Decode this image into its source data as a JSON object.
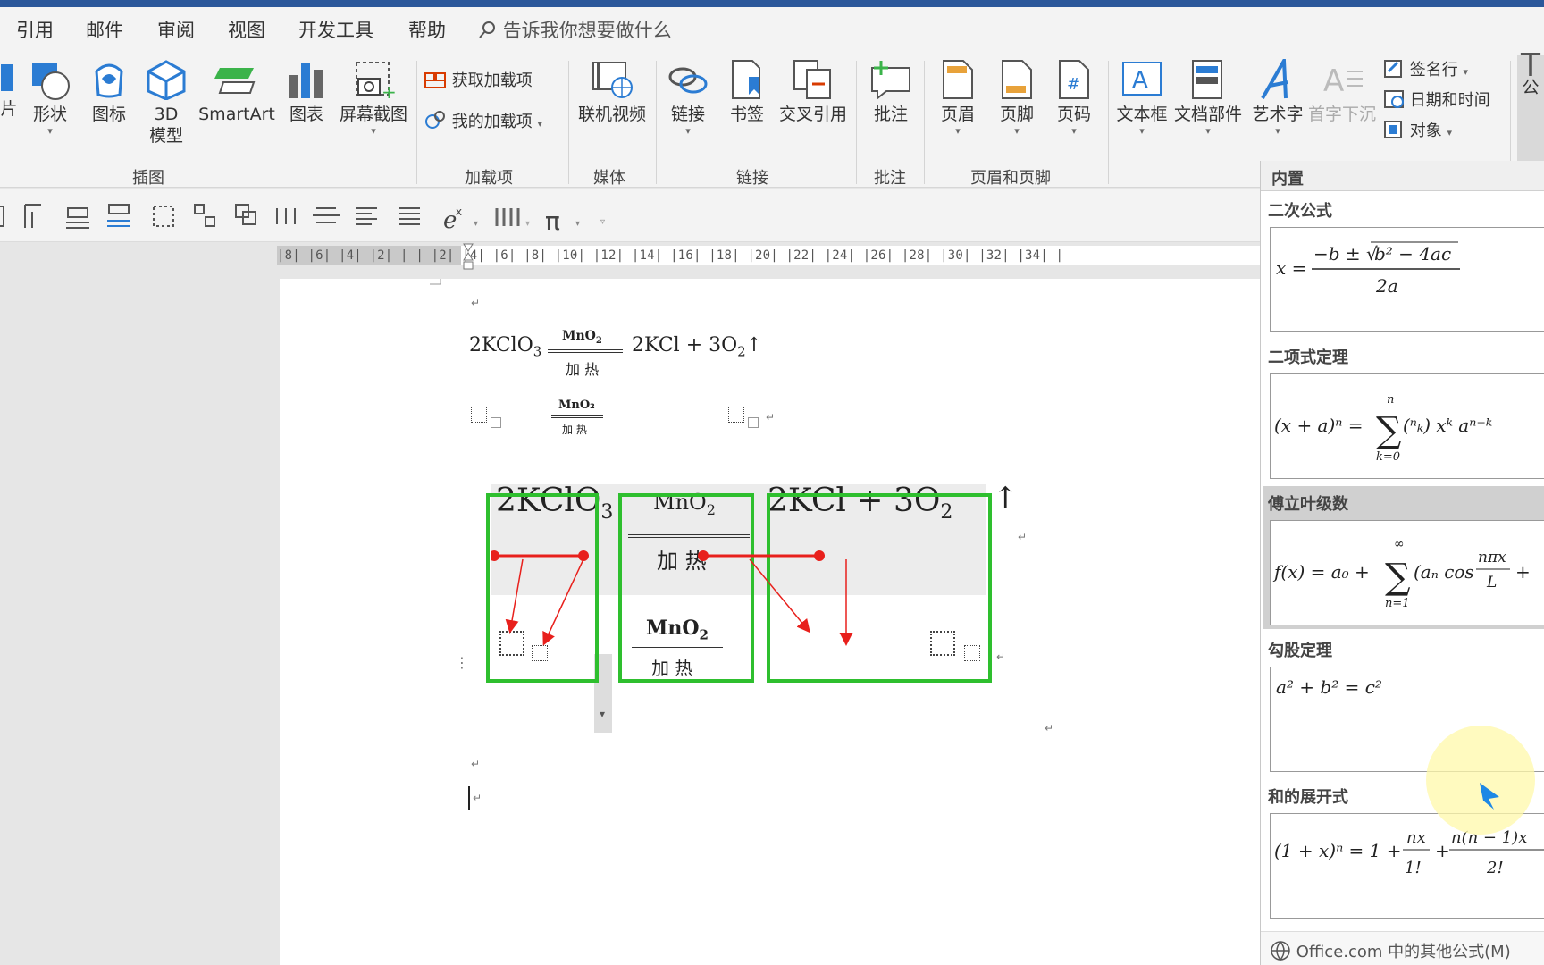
{
  "menu_tabs": [
    "引用",
    "邮件",
    "审阅",
    "视图",
    "开发工具",
    "帮助"
  ],
  "tell_me": "告诉我你想要做什么",
  "ribbon": {
    "illustrations": {
      "picture_partial": "片",
      "shapes": "形状",
      "icons": "图标",
      "model_3d": "3D\n模型",
      "smartart": "SmartArt",
      "chart": "图表",
      "screenshot": "屏幕截图",
      "group": "插图"
    },
    "addins": {
      "get": "获取加载项",
      "mine": "我的加载项",
      "group": "加载项"
    },
    "media": {
      "online_video": "联机视频",
      "group": "媒体"
    },
    "links": {
      "link": "链接",
      "bookmark": "书签",
      "cross_ref": "交叉引用",
      "group": "链接"
    },
    "comments": {
      "comment": "批注",
      "group": "批注"
    },
    "header_footer": {
      "header": "页眉",
      "footer": "页脚",
      "page_number": "页码",
      "group": "页眉和页脚"
    },
    "text": {
      "textbox": "文本框",
      "quick_parts": "文档部件",
      "wordart": "艺术字",
      "drop_cap": "首字下沉",
      "signature": "签名行",
      "datetime": "日期和时间",
      "object": "对象"
    },
    "equation_partial": "公"
  },
  "ruler_text": "|8| |6| |4| |2| | |  |2| |4| |6| |8| |10| |12| |14| |16| |18| |20| |22| |24| |26| |28| |30| |32| |34| |",
  "document": {
    "line1": {
      "left": "2KClO",
      "left_sub": "3",
      "over": "MnO",
      "over_sub": "2",
      "under": "加  热",
      "right": "2KCl  +  3O",
      "right_sub": "2",
      "arrow": "↑"
    },
    "line2": {
      "over": "MnO₂",
      "under": "加 热"
    },
    "big": {
      "left": "2KClO",
      "left_sub": "3",
      "over": "MnO",
      "over_sub": "2",
      "under": "加   热",
      "over2": "MnO",
      "over2_sub": "2",
      "under2": "加 热",
      "right": "2KCl  +  3O",
      "right_sub": "2",
      "arrow": "↑"
    },
    "para_mark": "↵"
  },
  "panel": {
    "header": "内置",
    "sections": [
      {
        "title": "二次公式",
        "formula": "x = (−b ± √(b² − 4ac)) / 2a"
      },
      {
        "title": "二项式定理",
        "formula": "(x + a)ⁿ = Σ (n k) xᵏ aⁿ⁻ᵏ"
      },
      {
        "title": "傅立叶级数",
        "formula": "f(x) = a₀ + Σ (aₙ cos nπx/L +"
      },
      {
        "title": "勾股定理",
        "formula": "a² + b² = c²"
      },
      {
        "title": "和的展开式",
        "formula": "(1 + x)ⁿ = 1 + nx/1! + n(n − 1)x"
      }
    ],
    "footer": "Office.com 中的其他公式(M)"
  },
  "colors": {
    "accent": "#2b579a",
    "green_box": "#2ebf2e",
    "red_arrow": "#e8201c",
    "cursor": "#1e88e5"
  }
}
